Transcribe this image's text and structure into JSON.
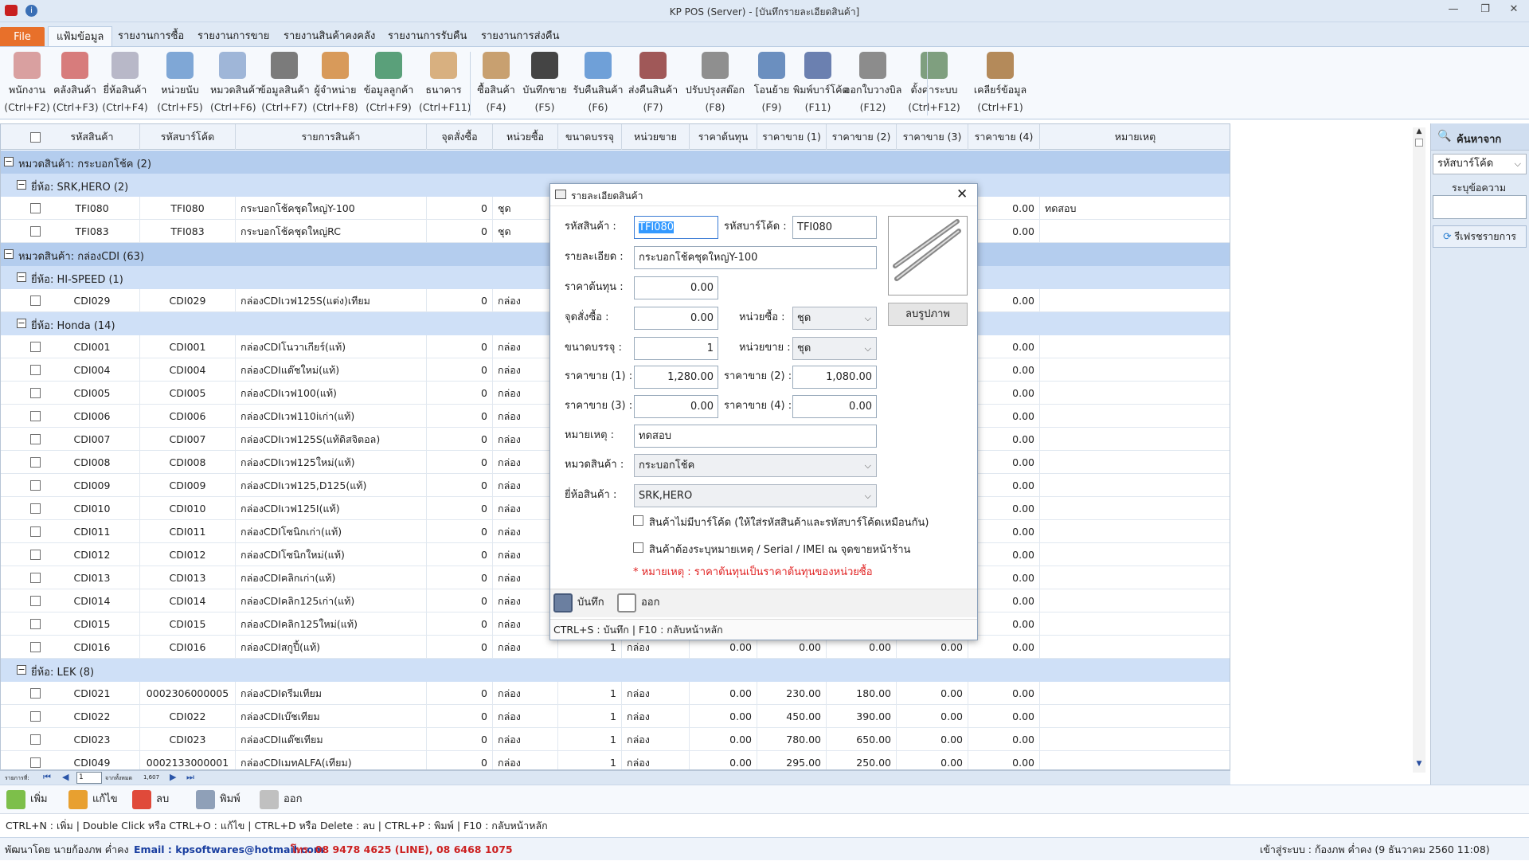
{
  "window": {
    "title": "KP POS (Server) - [บันทึกรายละเอียดสินค้า]"
  },
  "menu": {
    "file": "File",
    "tabs": [
      "แฟ้มข้อมูล",
      "รายงานการซื้อ",
      "รายงานการขาย",
      "รายงานสินค้าคงคลัง",
      "รายงานการรับคืน",
      "รายงานการส่งคืน"
    ]
  },
  "ribbon": [
    {
      "label": "พนักงาน",
      "shortcut": "(Ctrl+F2)",
      "icon": "employee-icon"
    },
    {
      "label": "คลังสินค้า",
      "shortcut": "(Ctrl+F3)",
      "icon": "warehouse-icon"
    },
    {
      "label": "ยี่ห้อสินค้า",
      "shortcut": "(Ctrl+F4)",
      "icon": "brand-icon"
    },
    {
      "label": "หน่วยนับ",
      "shortcut": "(Ctrl+F5)",
      "icon": "unit-icon"
    },
    {
      "label": "หมวดสินค้า",
      "shortcut": "(Ctrl+F6)",
      "icon": "category-icon"
    },
    {
      "label": "ข้อมูลสินค้า",
      "shortcut": "(Ctrl+F7)",
      "icon": "product-icon"
    },
    {
      "label": "ผู้จำหน่าย",
      "shortcut": "(Ctrl+F8)",
      "icon": "supplier-icon"
    },
    {
      "label": "ข้อมูลลูกค้า",
      "shortcut": "(Ctrl+F9)",
      "icon": "customer-icon"
    },
    {
      "label": "ธนาคาร",
      "shortcut": "(Ctrl+F11)",
      "icon": "bank-icon"
    },
    {
      "label": "ซื้อสินค้า",
      "shortcut": "(F4)",
      "icon": "purchase-icon"
    },
    {
      "label": "บันทึกขาย",
      "shortcut": "(F5)",
      "icon": "sale-icon"
    },
    {
      "label": "รับคืนสินค้า",
      "shortcut": "(F6)",
      "icon": "receive-return-icon"
    },
    {
      "label": "ส่งคืนสินค้า",
      "shortcut": "(F7)",
      "icon": "send-return-icon"
    },
    {
      "label": "ปรับปรุงสต๊อก",
      "shortcut": "(F8)",
      "icon": "stock-adjust-icon"
    },
    {
      "label": "โอนย้าย",
      "shortcut": "(F9)",
      "icon": "transfer-icon"
    },
    {
      "label": "พิมพ์บาร์โค้ด",
      "shortcut": "(F11)",
      "icon": "barcode-icon"
    },
    {
      "label": "ออกใบวางบิล",
      "shortcut": "(F12)",
      "icon": "billing-icon"
    },
    {
      "label": "ตั้งค่าระบบ",
      "shortcut": "(Ctrl+F12)",
      "icon": "settings-icon"
    },
    {
      "label": "เคลียร์ข้อมูล",
      "shortcut": "(Ctrl+F1)",
      "icon": "clear-data-icon"
    }
  ],
  "grid": {
    "columns": [
      "รหัสสินค้า",
      "รหัสบาร์โค้ด",
      "รายการสินค้า",
      "จุดสั่งซื้อ",
      "หน่วยซื้อ",
      "ขนาดบรรจุ",
      "หน่วยขาย",
      "ราคาต้นทุน",
      "ราคาขาย (1)",
      "ราคาขาย (2)",
      "ราคาขาย (3)",
      "ราคาขาย (4)",
      "หมายเหตุ"
    ],
    "rows": [
      {
        "type": "cat",
        "text": "หมวดสินค้า:  กระบอกโช้ค (2)"
      },
      {
        "type": "brand",
        "text": "ยี่ห้อ:  SRK,HERO (2)"
      },
      {
        "type": "item",
        "cells": [
          "TFI080",
          "TFI080",
          "กระบอกโช้คชุดใหญ่Y-100",
          "0",
          "ชุด",
          "",
          "",
          "",
          "",
          "",
          "",
          "0.00",
          "ทดสอบ"
        ]
      },
      {
        "type": "item",
        "cells": [
          "TFI083",
          "TFI083",
          "กระบอกโช้คชุดใหญ่RC",
          "0",
          "ชุด",
          "",
          "",
          "",
          "",
          "",
          "",
          "0.00",
          ""
        ]
      },
      {
        "type": "cat",
        "text": "หมวดสินค้า:  กล่องCDI (63)"
      },
      {
        "type": "brand",
        "text": "ยี่ห้อ:  HI-SPEED (1)"
      },
      {
        "type": "item",
        "cells": [
          "CDI029",
          "CDI029",
          "กล่องCDIเวฟ125S(แต่ง)เทียม",
          "0",
          "กล่อง",
          "",
          "",
          "",
          "",
          "",
          "",
          "0.00",
          ""
        ]
      },
      {
        "type": "brand",
        "text": "ยี่ห้อ:  Honda (14)"
      },
      {
        "type": "item",
        "cells": [
          "CDI001",
          "CDI001",
          "กล่องCDIโนวาเกียร์(แท้)",
          "0",
          "กล่อง",
          "",
          "",
          "",
          "",
          "",
          "",
          "0.00",
          ""
        ]
      },
      {
        "type": "item",
        "cells": [
          "CDI004",
          "CDI004",
          "กล่องCDIแด๊ชใหม่(แท้)",
          "0",
          "กล่อง",
          "",
          "",
          "",
          "",
          "",
          "",
          "0.00",
          ""
        ]
      },
      {
        "type": "item",
        "cells": [
          "CDI005",
          "CDI005",
          "กล่องCDIเวฟ100(แท้)",
          "0",
          "กล่อง",
          "",
          "",
          "",
          "",
          "",
          "",
          "0.00",
          ""
        ]
      },
      {
        "type": "item",
        "cells": [
          "CDI006",
          "CDI006",
          "กล่องCDIเวฟ110iเก่า(แท้)",
          "0",
          "กล่อง",
          "",
          "",
          "",
          "",
          "",
          "",
          "0.00",
          ""
        ]
      },
      {
        "type": "item",
        "cells": [
          "CDI007",
          "CDI007",
          "กล่องCDIเวฟ125S(แท้ดิสจิตอล)",
          "0",
          "กล่อง",
          "",
          "",
          "",
          "",
          "",
          "",
          "0.00",
          ""
        ]
      },
      {
        "type": "item",
        "cells": [
          "CDI008",
          "CDI008",
          "กล่องCDIเวฟ125ใหม่(แท้)",
          "0",
          "กล่อง",
          "",
          "",
          "",
          "",
          "",
          "",
          "0.00",
          ""
        ]
      },
      {
        "type": "item",
        "cells": [
          "CDI009",
          "CDI009",
          "กล่องCDIเวฟ125,D125(แท้)",
          "0",
          "กล่อง",
          "",
          "",
          "",
          "",
          "",
          "",
          "0.00",
          ""
        ]
      },
      {
        "type": "item",
        "cells": [
          "CDI010",
          "CDI010",
          "กล่องCDIเวฟ125I(แท้)",
          "0",
          "กล่อง",
          "",
          "",
          "",
          "",
          "",
          "",
          "0.00",
          ""
        ]
      },
      {
        "type": "item",
        "cells": [
          "CDI011",
          "CDI011",
          "กล่องCDIโซนิกเก่า(แท้)",
          "0",
          "กล่อง",
          "",
          "",
          "",
          "",
          "",
          "",
          "0.00",
          ""
        ]
      },
      {
        "type": "item",
        "cells": [
          "CDI012",
          "CDI012",
          "กล่องCDIโซนิกใหม่(แท้)",
          "0",
          "กล่อง",
          "",
          "",
          "",
          "",
          "",
          "",
          "0.00",
          ""
        ]
      },
      {
        "type": "item",
        "cells": [
          "CDI013",
          "CDI013",
          "กล่องCDIคลิกเก่า(แท้)",
          "0",
          "กล่อง",
          "",
          "",
          "",
          "",
          "",
          "",
          "0.00",
          ""
        ]
      },
      {
        "type": "item",
        "cells": [
          "CDI014",
          "CDI014",
          "กล่องCDIคลิก125เก่า(แท้)",
          "0",
          "กล่อง",
          "",
          "",
          "",
          "",
          "",
          "",
          "0.00",
          ""
        ]
      },
      {
        "type": "item",
        "cells": [
          "CDI015",
          "CDI015",
          "กล่องCDIคลิก125ใหม่(แท้)",
          "0",
          "กล่อง",
          "",
          "",
          "",
          "",
          "",
          "",
          "0.00",
          ""
        ]
      },
      {
        "type": "item",
        "cells": [
          "CDI016",
          "CDI016",
          "กล่องCDIสกูปี้(แท้)",
          "0",
          "กล่อง",
          "1",
          "กล่อง",
          "0.00",
          "0.00",
          "0.00",
          "0.00",
          "0.00",
          ""
        ]
      },
      {
        "type": "brand",
        "text": "ยี่ห้อ:  LEK (8)"
      },
      {
        "type": "item",
        "cells": [
          "CDI021",
          "0002306000005",
          "กล่องCDIดรีมเทียม",
          "0",
          "กล่อง",
          "1",
          "กล่อง",
          "0.00",
          "230.00",
          "180.00",
          "0.00",
          "0.00",
          ""
        ]
      },
      {
        "type": "item",
        "cells": [
          "CDI022",
          "CDI022",
          "กล่องCDIเบ๊ชเทียม",
          "0",
          "กล่อง",
          "1",
          "กล่อง",
          "0.00",
          "450.00",
          "390.00",
          "0.00",
          "0.00",
          ""
        ]
      },
      {
        "type": "item",
        "cells": [
          "CDI023",
          "CDI023",
          "กล่องCDIแด๊ชเทียม",
          "0",
          "กล่อง",
          "1",
          "กล่อง",
          "0.00",
          "780.00",
          "650.00",
          "0.00",
          "0.00",
          ""
        ]
      },
      {
        "type": "item",
        "cells": [
          "CDI049",
          "0002133000001",
          "กล่องCDIเมทALFA(เทียม)",
          "0",
          "กล่อง",
          "1",
          "กล่อง",
          "0.00",
          "295.00",
          "250.00",
          "0.00",
          "0.00",
          ""
        ]
      }
    ]
  },
  "nav": {
    "rows_label": "รายการที่:",
    "page": "1",
    "of_label": "จากทั้งหมด",
    "total": "1,607"
  },
  "side": {
    "title": "ค้นหาจาก",
    "search_by": "รหัสบาร์โค้ด",
    "term_label": "ระบุข้อความ",
    "term_value": "",
    "refresh": "รีเฟรชรายการ"
  },
  "bottom_buttons": [
    {
      "label": "เพิ่ม",
      "icon": "add-icon"
    },
    {
      "label": "แก้ไข",
      "icon": "edit-icon"
    },
    {
      "label": "ลบ",
      "icon": "delete-icon"
    },
    {
      "label": "พิมพ์",
      "icon": "print-icon"
    },
    {
      "label": "ออก",
      "icon": "exit-icon"
    }
  ],
  "hint": "CTRL+N : เพิ่ม   |   Double Click หรือ CTRL+O : แก้ไข   |   CTRL+D หรือ Delete : ลบ   |   CTRL+P : พิมพ์   |   F10 : กลับหน้าหลัก",
  "status": {
    "dev": "พัฒนาโดย นายก้องภพ ค่ำคง",
    "email": "Email : kpsoftwares@hotmail.com",
    "phone": "โทร. 08 9478 4625 (LINE), 08 6468 1075",
    "login": "เข้าสู่ระบบ : ก้องภพ ค่ำคง (9 ธันวาคม 2560 11:08)"
  },
  "dialog": {
    "title": "รายละเอียดสินค้า",
    "code_label": "รหัสสินค้า :",
    "code": "TFI080",
    "barcode_label": "รหัสบาร์โค้ด :",
    "barcode": "TFI080",
    "desc_label": "รายละเอียด :",
    "desc": "กระบอกโช้คชุดใหญ่Y-100",
    "cost_label": "ราคาต้นทุน :",
    "cost": "0.00",
    "reorder_label": "จุดสั่งซื้อ :",
    "reorder": "0.00",
    "buy_unit_label": "หน่วยซื้อ :",
    "buy_unit": "ชุด",
    "pack_label": "ขนาดบรรจุ :",
    "pack": "1",
    "sell_unit_label": "หน่วยขาย :",
    "sell_unit": "ชุด",
    "p1_label": "ราคาขาย (1) :",
    "p1": "1,280.00",
    "p2_label": "ราคาขาย (2) :",
    "p2": "1,080.00",
    "p3_label": "ราคาขาย (3) :",
    "p3": "0.00",
    "p4_label": "ราคาขาย (4) :",
    "p4": "0.00",
    "note_label": "หมายเหตุ :",
    "note": "ทดสอบ",
    "cat_label": "หมวดสินค้า :",
    "cat": "กระบอกโช้ค",
    "brand_label": "ยี่ห้อสินค้า :",
    "brand": "SRK,HERO",
    "remove_image": "ลบรูปภาพ",
    "chk1": "สินค้าไม่มีบาร์โค้ด (ให้ใส่รหัสสินค้าและรหัสบาร์โค้ดเหมือนกัน)",
    "chk2": "สินค้าต้องระบุหมายเหตุ / Serial / IMEI ณ จุดขายหน้าร้าน",
    "remark": "* หมายเหตุ : ราคาต้นทุนเป็นราคาต้นทุนของหน่วยซื้อ",
    "save": "บันทึก",
    "exit": "ออก",
    "footer": "CTRL+S : บันทึก   |   F10 : กลับหน้าหลัก"
  },
  "colors": {
    "accent": "#e8702a",
    "group_cat": "#b4cdee",
    "group_brand": "#cfe0f7",
    "remark": "#e02020",
    "email": "#1a3fa0",
    "phone": "#cc2020"
  }
}
